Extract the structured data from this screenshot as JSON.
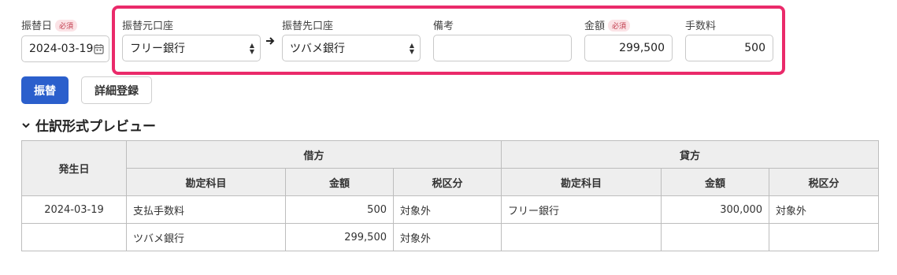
{
  "form": {
    "date": {
      "label": "振替日",
      "badge": "必須",
      "value": "2024-03-19"
    },
    "from_account": {
      "label": "振替元口座",
      "value": "フリー銀行"
    },
    "to_account": {
      "label": "振替先口座",
      "value": "ツバメ銀行"
    },
    "memo": {
      "label": "備考",
      "value": ""
    },
    "amount": {
      "label": "金額",
      "badge": "必須",
      "value": "299,500"
    },
    "fee": {
      "label": "手数料",
      "value": "500"
    }
  },
  "buttons": {
    "transfer": "振替",
    "detail": "詳細登録"
  },
  "preview": {
    "title": "仕訳形式プレビュー",
    "headers": {
      "date": "発生日",
      "debit": "借方",
      "credit": "貸方",
      "account": "勘定科目",
      "amount": "金額",
      "tax": "税区分"
    },
    "rows": [
      {
        "date": "2024-03-19",
        "debit_account": "支払手数料",
        "debit_amount": "500",
        "debit_tax": "対象外",
        "credit_account": "フリー銀行",
        "credit_amount": "300,000",
        "credit_tax": "対象外"
      },
      {
        "date": "",
        "debit_account": "ツバメ銀行",
        "debit_amount": "299,500",
        "debit_tax": "対象外",
        "credit_account": "",
        "credit_amount": "",
        "credit_tax": ""
      }
    ]
  },
  "colors": {
    "highlight": "#ea2a6a",
    "primary": "#2b5fcc",
    "required_badge": "#c0394b"
  }
}
